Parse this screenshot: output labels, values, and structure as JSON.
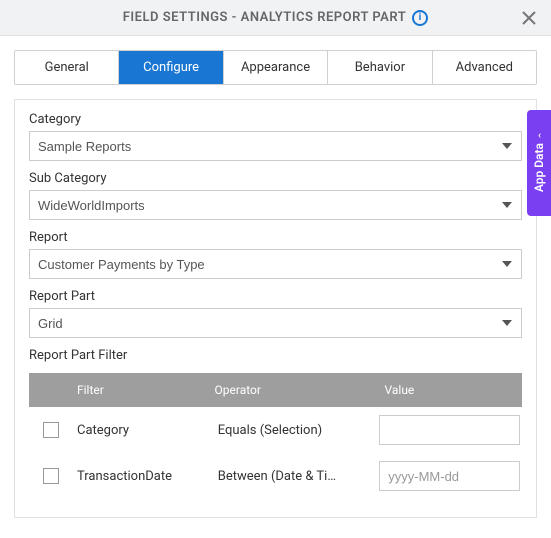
{
  "header": {
    "title": "FIELD SETTINGS - ANALYTICS REPORT PART"
  },
  "tabs": {
    "items": [
      "General",
      "Configure",
      "Appearance",
      "Behavior",
      "Advanced"
    ],
    "activeIndex": 1
  },
  "fields": {
    "category": {
      "label": "Category",
      "value": "Sample Reports"
    },
    "subcategory": {
      "label": "Sub Category",
      "value": "WideWorldImports"
    },
    "report": {
      "label": "Report",
      "value": "Customer Payments by Type"
    },
    "reportPart": {
      "label": "Report Part",
      "value": "Grid"
    }
  },
  "filterSection": {
    "title": "Report Part Filter",
    "headers": {
      "filter": "Filter",
      "operator": "Operator",
      "value": "Value"
    },
    "rows": [
      {
        "filter": "Category",
        "operator": "Equals (Selection)",
        "value": "",
        "placeholder": ""
      },
      {
        "filter": "TransactionDate",
        "operator": "Between (Date & Ti…",
        "value": "",
        "placeholder": "yyyy-MM-dd"
      }
    ]
  },
  "sidePanel": {
    "label": "App Data"
  }
}
